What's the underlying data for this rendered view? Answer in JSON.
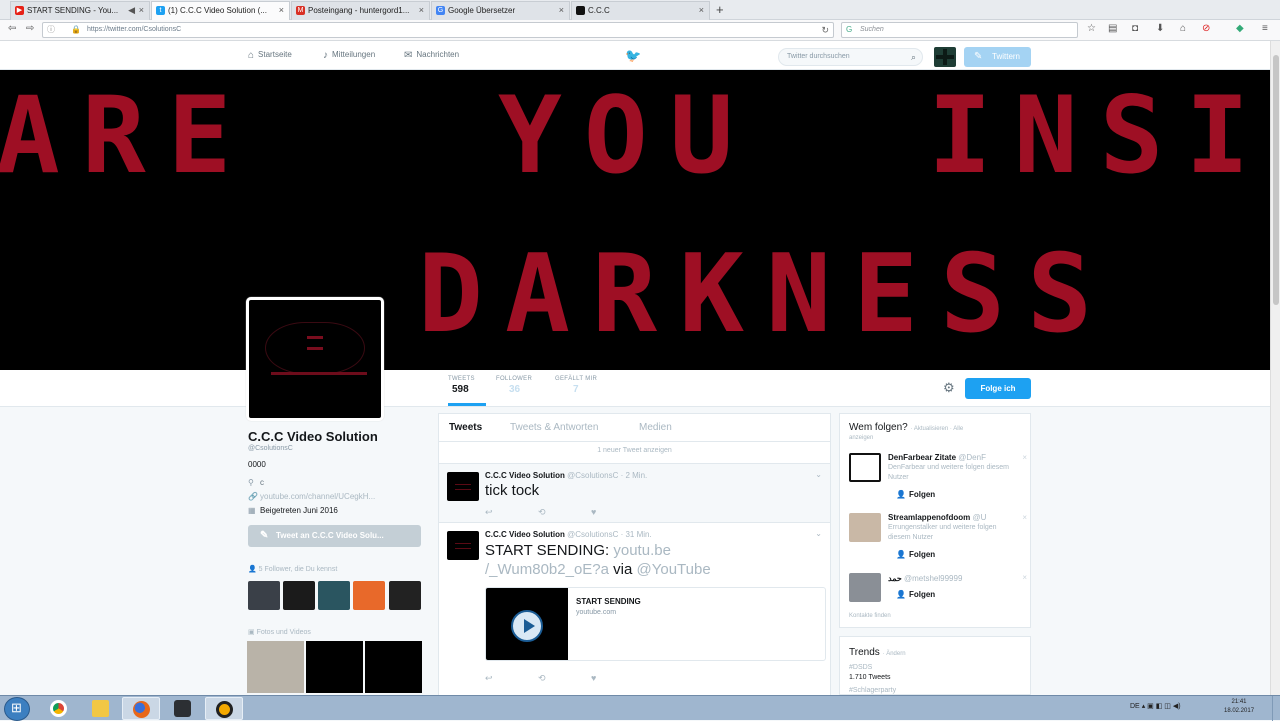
{
  "browser": {
    "tabs": [
      {
        "label": "START SENDING - You...",
        "icon": "youtube-icon",
        "active": false
      },
      {
        "label": "(1) C.C.C Video Solution (...",
        "icon": "twitter-icon",
        "active": true
      },
      {
        "label": "Posteingang - huntergord1...",
        "icon": "gmail-icon",
        "active": false
      },
      {
        "label": "Google Übersetzer",
        "icon": "google-translate-icon",
        "active": false
      },
      {
        "label": "C.C.C",
        "icon": "page-icon",
        "active": false
      }
    ],
    "new_tab": "+",
    "url": "https://twitter.com/CsolutionsC",
    "search_placeholder": "Suchen"
  },
  "twitter_nav": {
    "home": "Startseite",
    "notifications": "Mitteilungen",
    "messages": "Nachrichten",
    "search_placeholder": "Twitter durchsuchen",
    "tweet_button": "Twittern"
  },
  "banner": {
    "line1_left": "ARE",
    "line1_mid": "YOU",
    "line1_right": "INSIDE",
    "line2": "DARKNESS",
    "color": "#9e0f24"
  },
  "profile": {
    "name": "C.C.C Video Solution",
    "handle": "@CsolutionsC",
    "bio": "0000",
    "location": "c",
    "website": "youtube.com/channel/UCegkH...",
    "joined": "Beigetreten Juni 2016",
    "tweet_to": "Tweet an C.C.C Video Solu...",
    "followers_you_know": "5 Follower, die Du kennst",
    "photos_title": "Fotos und Videos"
  },
  "stats": [
    {
      "label": "TWEETS",
      "value": "598"
    },
    {
      "label": "FOLLOWER",
      "value": "36"
    },
    {
      "label": "GEFÄLLT MIR",
      "value": "7"
    }
  ],
  "follow_button": "Folge ich",
  "tweets_tabs": [
    "Tweets",
    "Tweets & Antworten",
    "Medien"
  ],
  "new_tweets": "1 neuer Tweet anzeigen",
  "tweets": [
    {
      "name": "C.C.C Video Solution",
      "handle": "@CsolutionsC",
      "time": "· 2 Min.",
      "text": "tick tock"
    },
    {
      "name": "C.C.C Video Solution",
      "handle": "@CsolutionsC",
      "time": "· 31 Min.",
      "text_a": "START SENDING:",
      "link1": "youtu.be",
      "link2": "/_Wum80b2_oE?a",
      "via": "via",
      "mention": "@YouTube",
      "card_title": "START SENDING",
      "card_url": "youtube.com"
    }
  ],
  "who_to_follow": {
    "title": "Wem folgen?",
    "refresh": "· Aktualisieren · Alle",
    "sub": "anzeigen",
    "suggestions": [
      {
        "name": "DenFarbear Zitate",
        "handle": "@DenF",
        "desc": "DenFarbear und weitere folgen diesem Nutzer",
        "follow": "Folgen"
      },
      {
        "name": "Streamlappenofdoom",
        "handle": "@U",
        "desc": "Errungenstalker und weitere folgen diesem Nutzer",
        "follow": "Folgen"
      },
      {
        "name": "حمد",
        "handle": "@metshel99999",
        "desc": "",
        "follow": "Folgen"
      }
    ],
    "contacts": "Kontakte finden"
  },
  "trends": {
    "title": "Trends",
    "change": "· Ändern",
    "items": [
      {
        "tag": "#DSDS",
        "count": "1.710 Tweets"
      },
      {
        "tag": "#Schlagerparty",
        "count": ""
      }
    ]
  },
  "taskbar": {
    "tray": "DE",
    "time": "21:41",
    "date": "18.02.2017"
  }
}
